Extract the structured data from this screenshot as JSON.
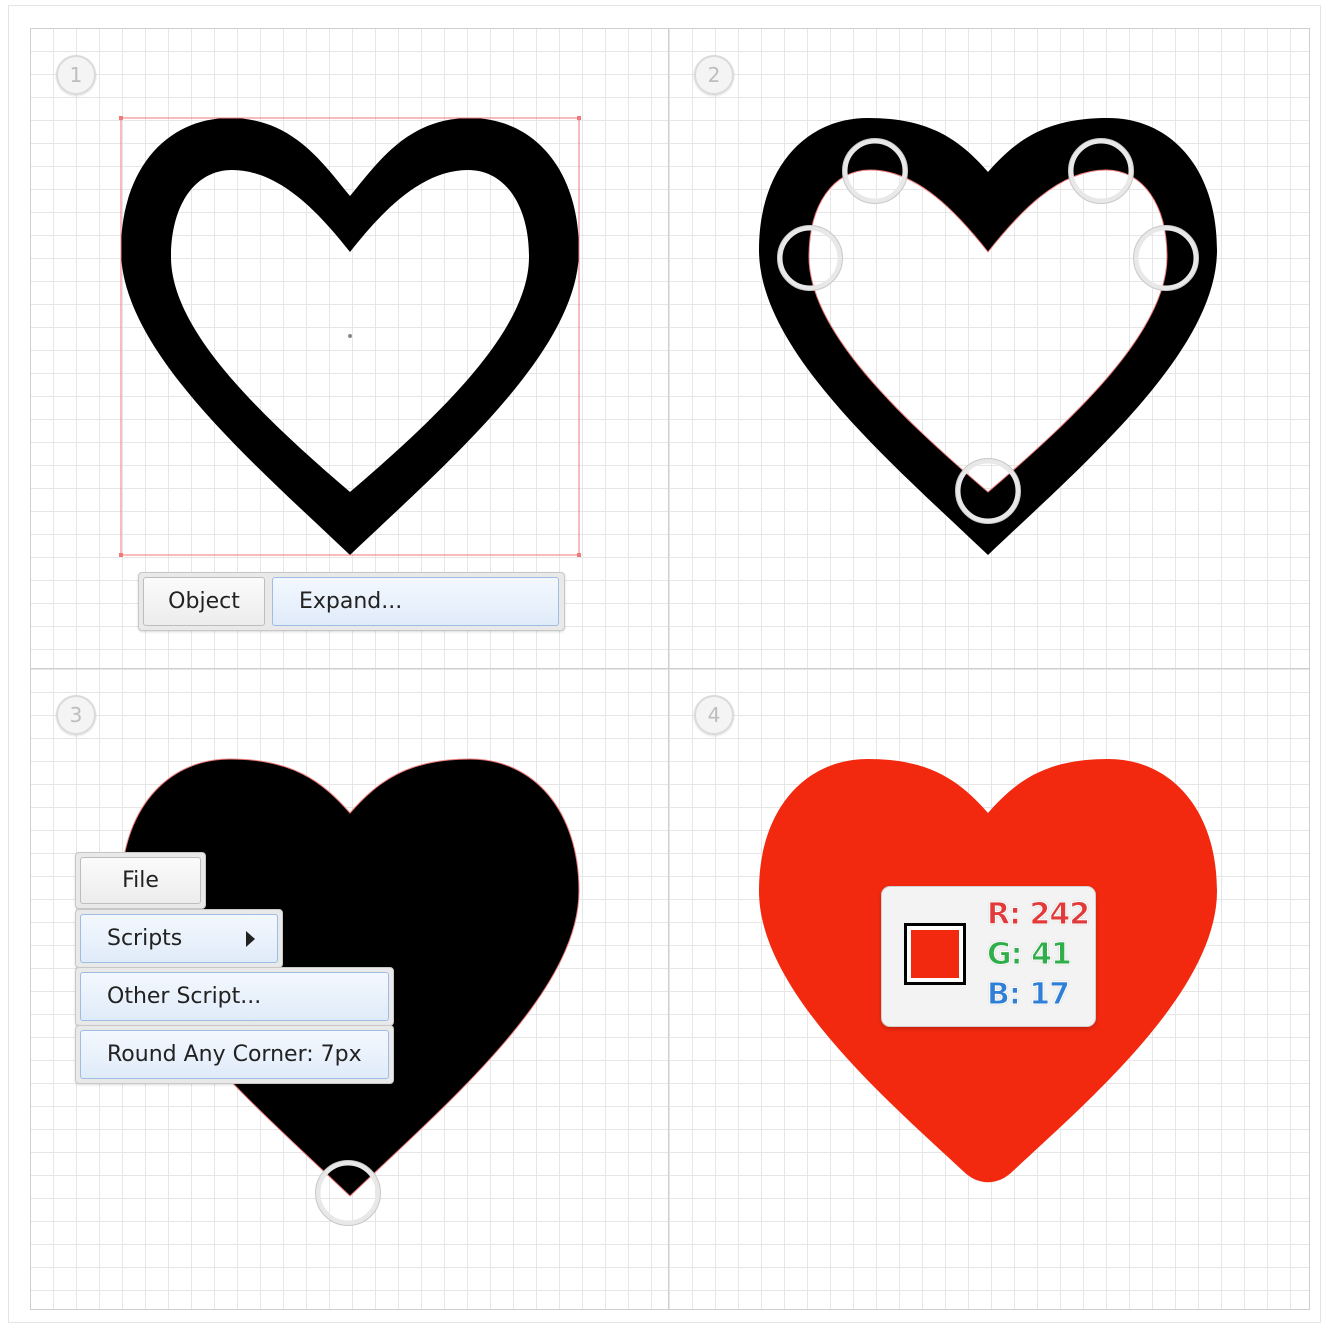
{
  "steps": [
    "1",
    "2",
    "3",
    "4"
  ],
  "step1": {
    "menu": {
      "object_label": "Object",
      "expand_label": "Expand..."
    }
  },
  "step3": {
    "menu": {
      "file_label": "File",
      "scripts_label": "Scripts",
      "other_script_label": "Other Script...",
      "round_corner_label": "Round Any Corner: 7px"
    }
  },
  "step4": {
    "fill_color": "#f2290f",
    "rgb": {
      "r_label": "R: 242",
      "g_label": "G: 41",
      "b_label": "B: 17"
    },
    "label_colors": {
      "r": "#e23a3a",
      "g": "#2fae4a",
      "b": "#2f7fd6"
    }
  },
  "colors": {
    "shape": "#000000",
    "selection": "#f07a7a",
    "highlight_ring": "#e0e0e0"
  }
}
